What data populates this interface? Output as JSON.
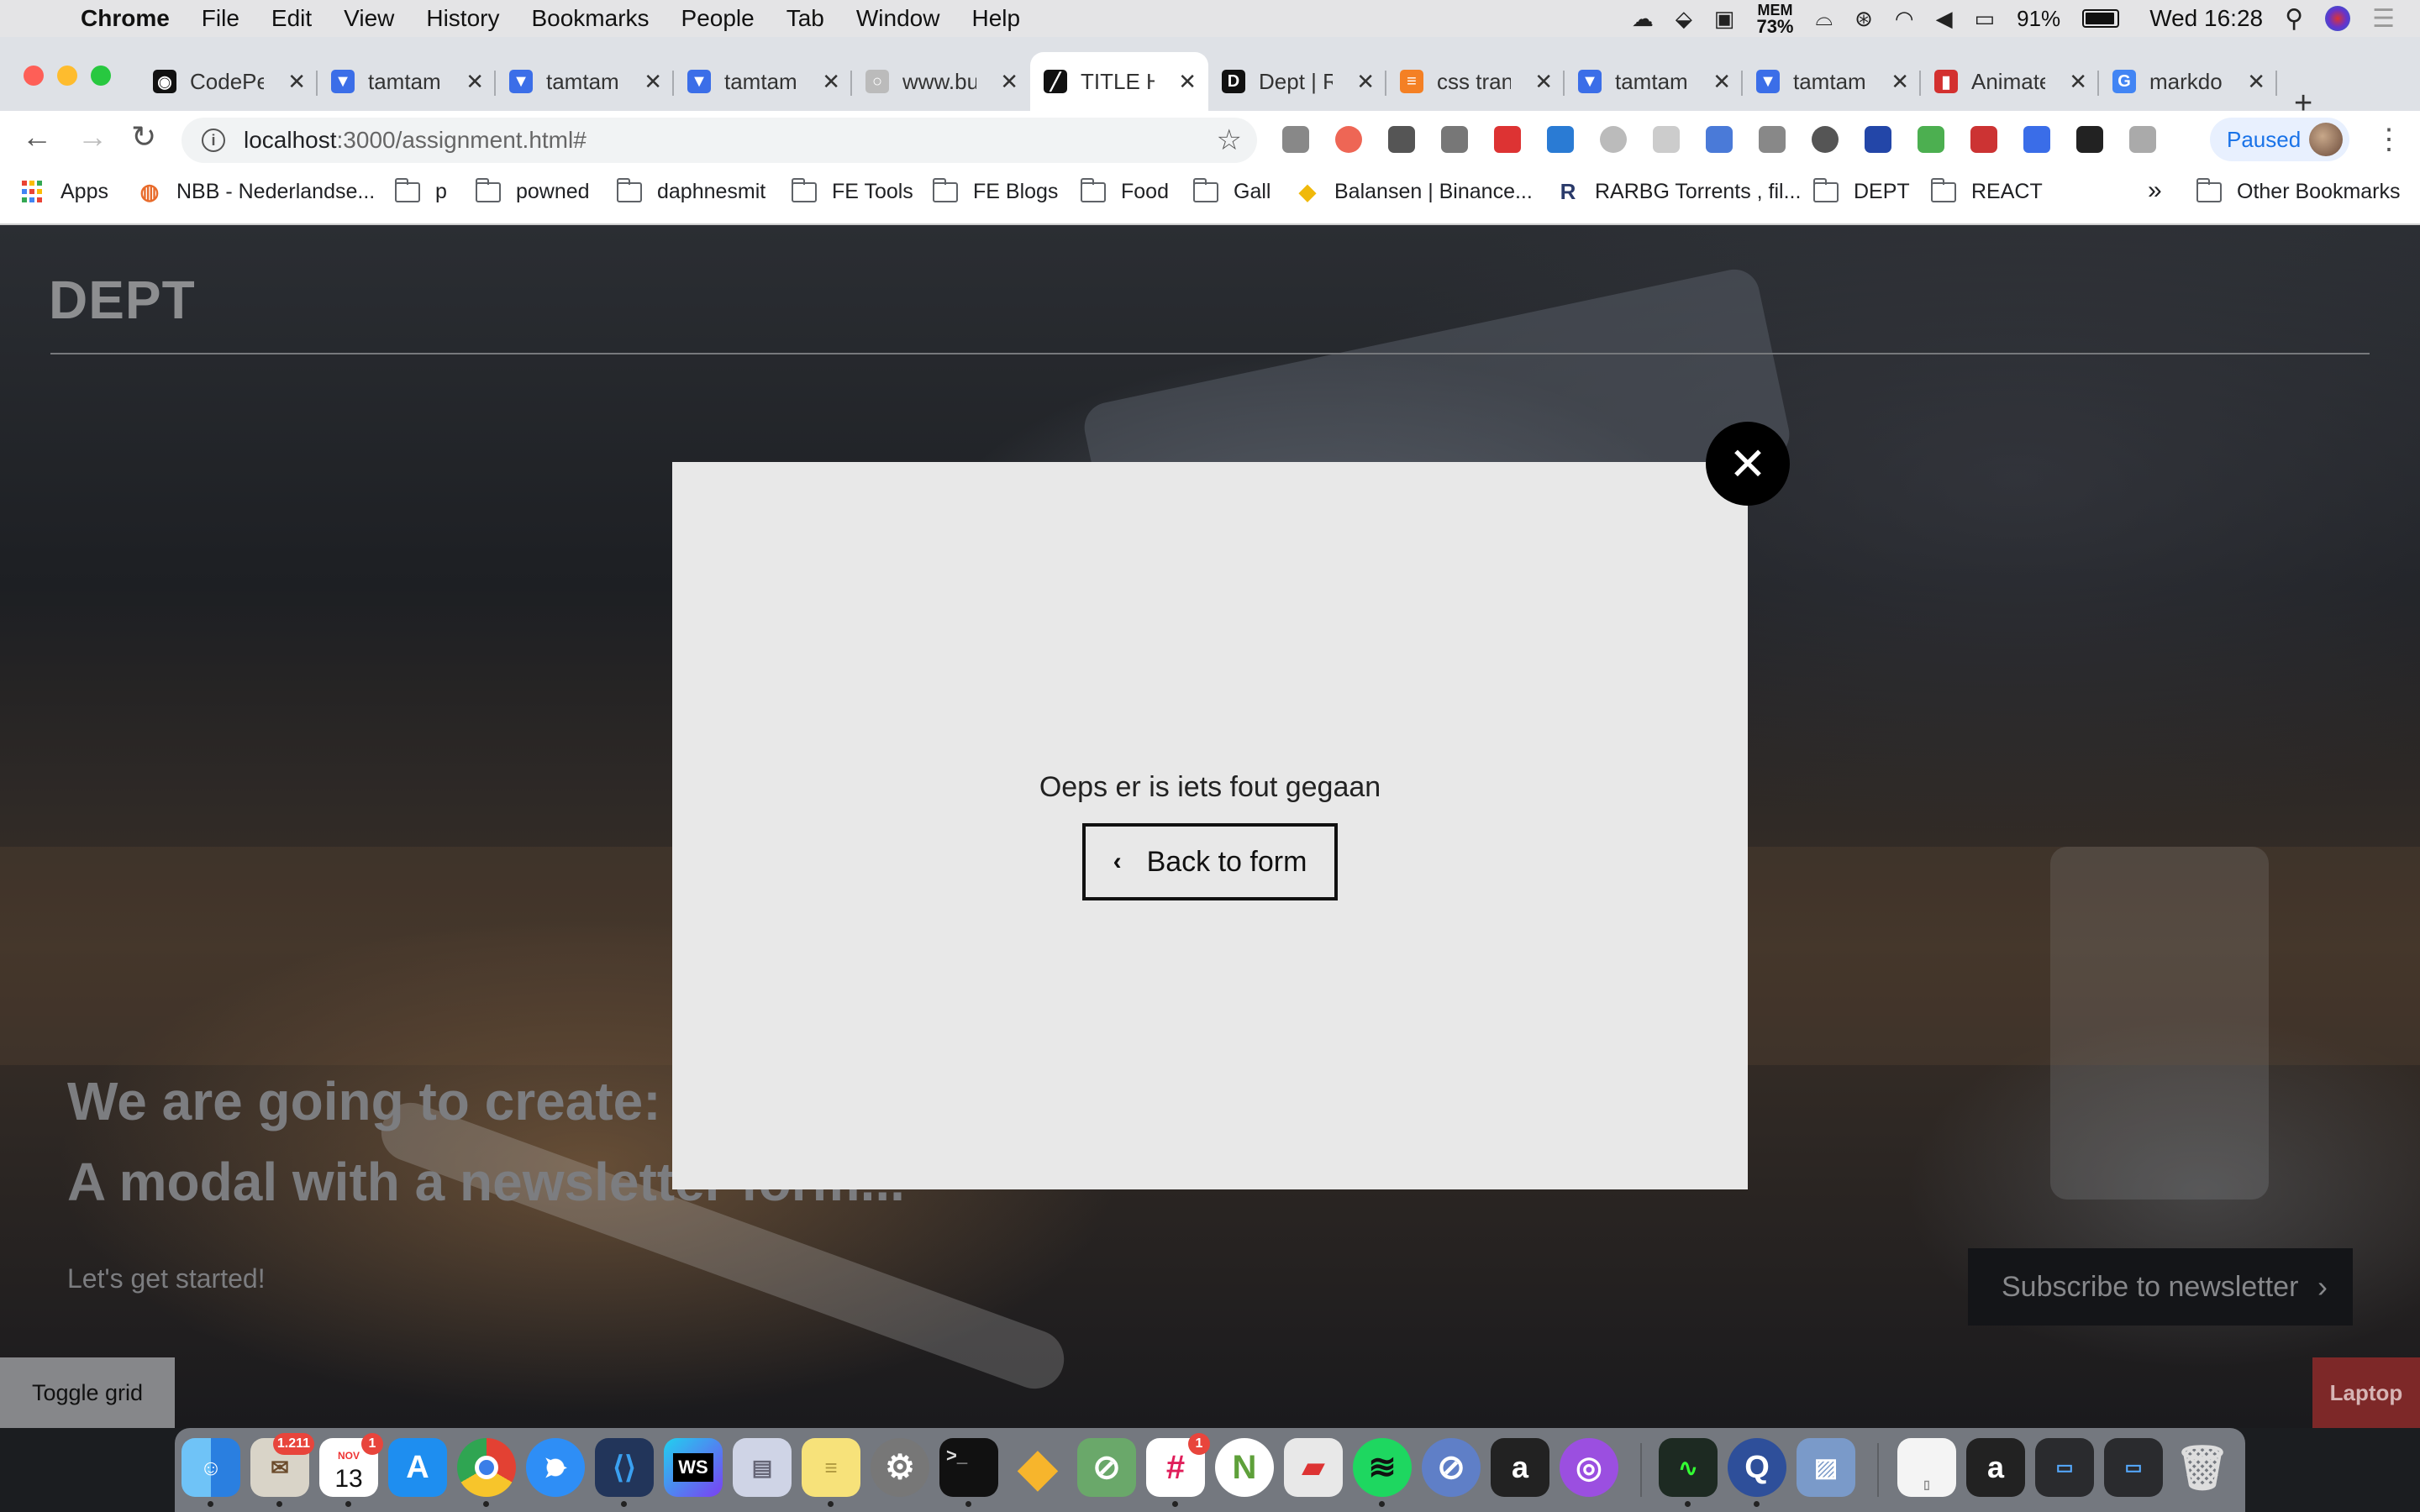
{
  "menubar": {
    "app": "Chrome",
    "items": [
      "File",
      "Edit",
      "View",
      "History",
      "Bookmarks",
      "People",
      "Tab",
      "Window",
      "Help"
    ],
    "mem_label": "MEM",
    "mem_value": "73%",
    "battery": "91%",
    "clock": "Wed 16:28"
  },
  "tabs": [
    {
      "title": "CodePe",
      "color": "#111111",
      "glyph": "◉"
    },
    {
      "title": "tamtam",
      "color": "#3b6ee8",
      "glyph": "▼"
    },
    {
      "title": "tamtam",
      "color": "#3b6ee8",
      "glyph": "▼"
    },
    {
      "title": "tamtam",
      "color": "#3b6ee8",
      "glyph": "▼"
    },
    {
      "title": "www.bu",
      "color": "#bbbbbb",
      "glyph": "○"
    },
    {
      "title": "TITLE H",
      "color": "#111111",
      "glyph": "╱"
    },
    {
      "title": "Dept | R",
      "color": "#111111",
      "glyph": "D"
    },
    {
      "title": "css tran",
      "color": "#f48024",
      "glyph": "≡"
    },
    {
      "title": "tamtam",
      "color": "#3b6ee8",
      "glyph": "▼"
    },
    {
      "title": "tamtam",
      "color": "#3b6ee8",
      "glyph": "▼"
    },
    {
      "title": "Animate",
      "color": "#d3302f",
      "glyph": "▮"
    },
    {
      "title": "markdo",
      "color": "#4285f4",
      "glyph": "G"
    }
  ],
  "toolbar": {
    "url_host": "localhost",
    "url_path": ":3000/assignment.html#",
    "profile_label": "Paused"
  },
  "bookmarks": [
    {
      "label": "Apps",
      "type": "apps"
    },
    {
      "label": "NBB - Nederlandse...",
      "type": "site",
      "color": "#e86b2b",
      "glyph": "◍"
    },
    {
      "label": "p",
      "type": "folder"
    },
    {
      "label": "powned",
      "type": "folder"
    },
    {
      "label": "daphnesmit",
      "type": "folder"
    },
    {
      "label": "FE Tools",
      "type": "folder"
    },
    {
      "label": "FE Blogs",
      "type": "folder"
    },
    {
      "label": "Food",
      "type": "folder"
    },
    {
      "label": "Gall",
      "type": "folder"
    },
    {
      "label": "Balansen | Binance...",
      "type": "site",
      "color": "#f0b90b",
      "glyph": "◆"
    },
    {
      "label": "RARBG Torrents , fil...",
      "type": "site",
      "color": "#2a3a6a",
      "glyph": "R"
    },
    {
      "label": "DEPT",
      "type": "folder"
    },
    {
      "label": "REACT",
      "type": "folder"
    }
  ],
  "bookmarks_overflow": "»",
  "other_bookmarks": "Other Bookmarks",
  "page": {
    "logo": "DEPT",
    "hero_line1": "We are going to create:",
    "hero_line2": "A modal with a newsletter form...",
    "subtitle": "Let's get started!",
    "subscribe_label": "Subscribe to newsletter",
    "toggle_grid_label": "Toggle grid",
    "breakpoint_label": "Laptop"
  },
  "modal": {
    "message": "Oeps er is iets fout gegaan",
    "back_label": "Back to form"
  },
  "dock": {
    "mail_badge": "1.211",
    "calendar_month": "NOV",
    "calendar_day": "13",
    "calendar_badge": "1",
    "slack_badge": "1",
    "webstorm_label": "WS"
  }
}
